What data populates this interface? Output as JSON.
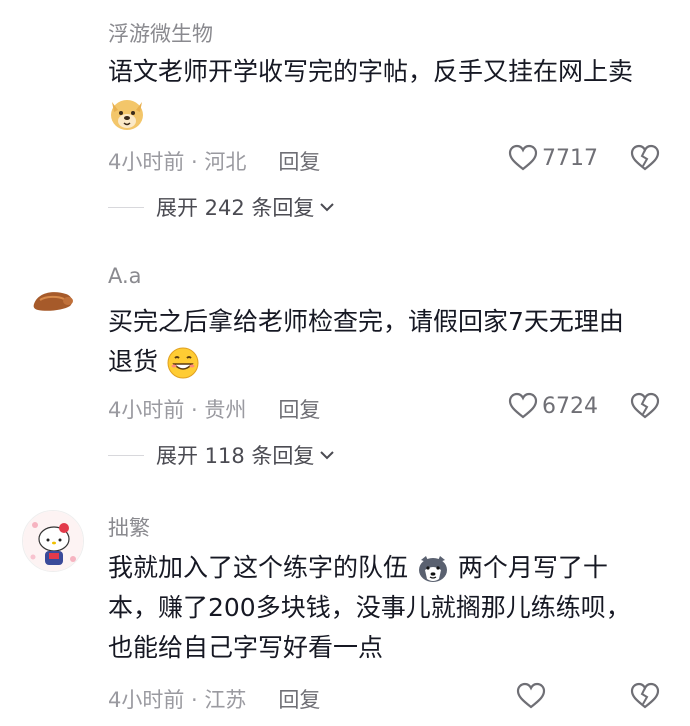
{
  "comments": [
    {
      "username": "浮游微生物",
      "text": "语文老师开学收写完的字帖，反手又挂在网上卖",
      "time_location": "4小时前 · 河北",
      "reply_label": "回复",
      "likes": "7717",
      "expand_label": "展开 242 条回复"
    },
    {
      "username": "A.a",
      "text_line1": "买完之后拿给老师检查完，请假回家7天无理由",
      "text_line2": "退货",
      "time_location": "4小时前 · 贵州",
      "reply_label": "回复",
      "likes": "6724",
      "expand_label": "展开 118 条回复"
    },
    {
      "username": "拙繁",
      "text_line1a": "我就加入了这个练字的队伍",
      "text_line1b": "两个月写了十",
      "text_line2": "本，赚了200多块钱，没事儿就搁那儿练练呗，",
      "text_line3": "也能给自己字写好看一点",
      "time_location": "4小时前 · 江苏",
      "reply_label": "回复"
    }
  ]
}
